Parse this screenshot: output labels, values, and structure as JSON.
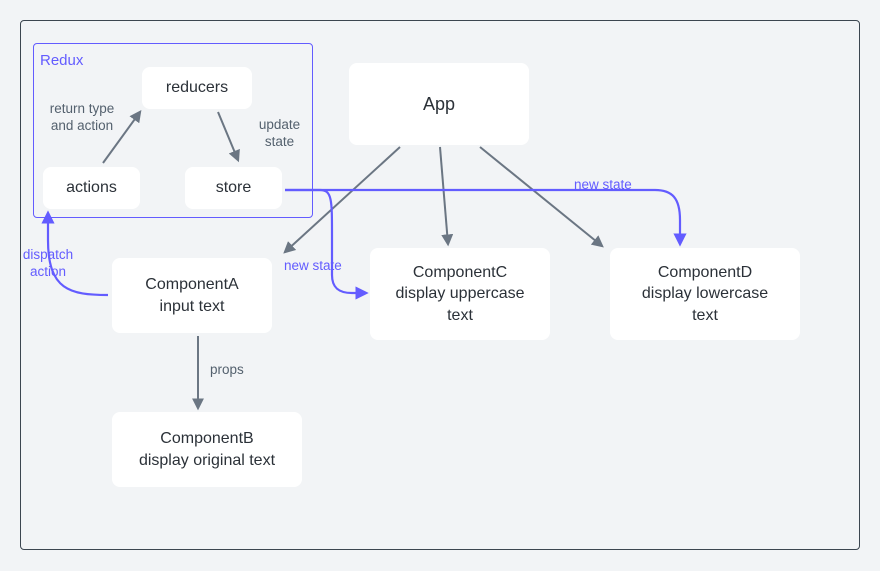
{
  "frame": {
    "redux_label": "Redux"
  },
  "nodes": {
    "reducers": "reducers",
    "actions": "actions",
    "store": "store",
    "app": "App",
    "componentA": "ComponentA\ninput text",
    "componentB": "ComponentB\ndisplay original text",
    "componentC": "ComponentC\ndisplay uppercase\ntext",
    "componentD": "ComponentD\ndisplay lowercase\ntext"
  },
  "labels": {
    "return_type_and_action": "return type\nand action",
    "update_state": "update\nstate",
    "dispatch_action": "dispatch\naction",
    "new_state_1": "new state",
    "new_state_2": "new state",
    "props": "props"
  }
}
